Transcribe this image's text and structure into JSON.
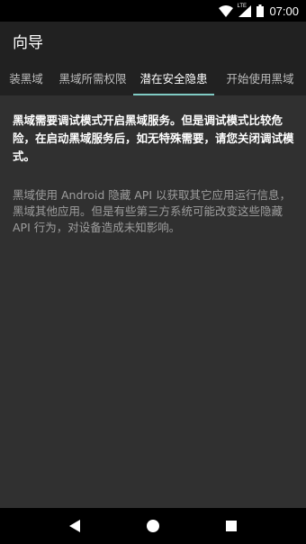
{
  "status_bar": {
    "time": "07:00",
    "network_label": "LTE",
    "icons": [
      "wifi-icon",
      "cellular-signal-icon",
      "battery-icon"
    ]
  },
  "toolbar": {
    "title": "向导"
  },
  "tabs": [
    {
      "label": "装黑域",
      "active": false
    },
    {
      "label": "黑域所需权限",
      "active": false
    },
    {
      "label": "潜在安全隐患",
      "active": true
    },
    {
      "label": "开始使用黑域",
      "active": false
    }
  ],
  "content": {
    "warning": "黑域需要调试模式开启黑域服务。但是调试模式比较危险，在启动黑域服务后，如无特殊需要，请您关闭调试模式。",
    "info": "黑域使用 Android 隐藏 API 以获取其它应用运行信息，黑域其他应用。但是有些第三方系统可能改变这些隐藏 API 行为，对设备造成未知影响。"
  },
  "nav_bar": {
    "icons": [
      "back-icon",
      "home-icon",
      "recents-icon"
    ]
  },
  "colors": {
    "toolbar_bg": "#212121",
    "content_bg": "#303030",
    "tab_indicator": "#80cbc4",
    "secondary_text": "#9e9e9e"
  }
}
